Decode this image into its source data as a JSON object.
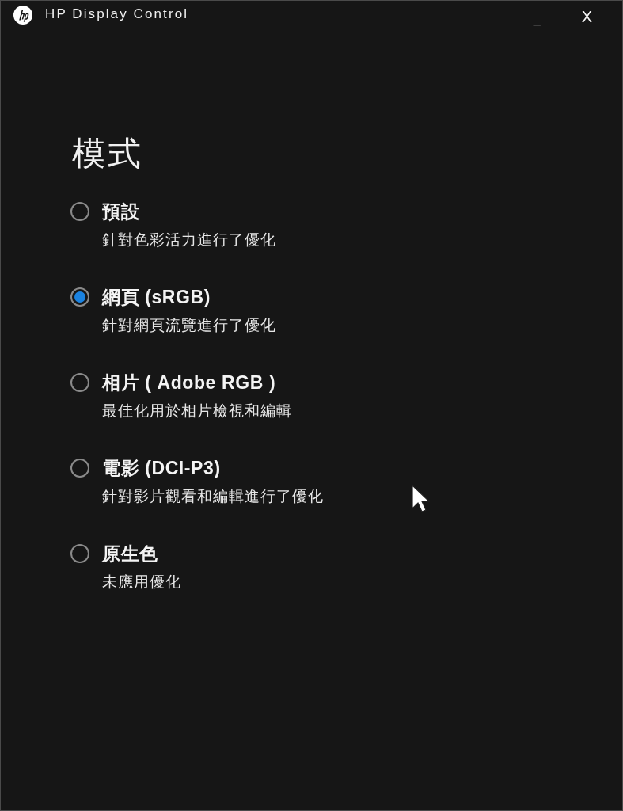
{
  "window": {
    "title": "HP Display Control",
    "controls": [
      {
        "label": "_"
      },
      {
        "label": "X"
      }
    ]
  },
  "mode": {
    "heading": "模式",
    "options": [
      {
        "label": "預設",
        "description": "針對色彩活力進行了優化",
        "selected": false
      },
      {
        "label": "網頁 (sRGB)",
        "description": "針對網頁流覽進行了優化",
        "selected": true
      },
      {
        "label": "相片 ( Adobe RGB )",
        "description": "最佳化用於相片檢視和編輯",
        "selected": false
      },
      {
        "label": "電影 (DCI-P3)",
        "description": "針對影片觀看和編輯進行了優化",
        "selected": false
      },
      {
        "label": "原生色",
        "description": "未應用優化",
        "selected": false
      }
    ]
  }
}
